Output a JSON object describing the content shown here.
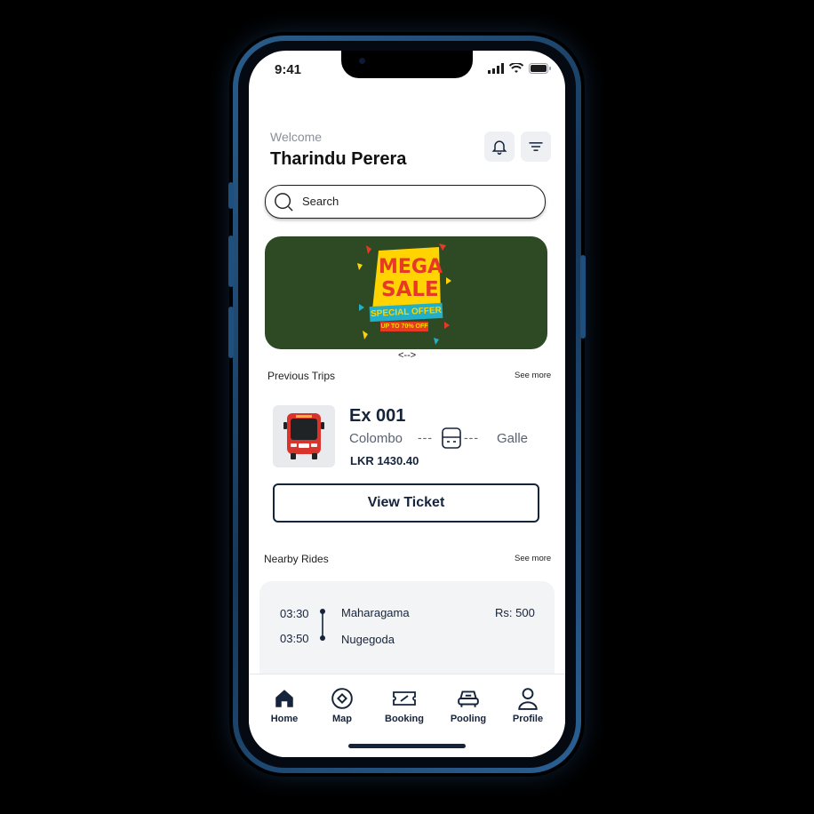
{
  "status_bar": {
    "time": "9:41"
  },
  "header": {
    "welcome": "Welcome",
    "user_name": "Tharindu Perera"
  },
  "search": {
    "placeholder": "Search"
  },
  "banner": {
    "title_line1": "MEGA",
    "title_line2": "SALE",
    "offer": "SPECIAL OFFER",
    "sub": "UP TO 70% OFF",
    "background": "#2e4a25"
  },
  "swipe_hint": "<-->",
  "previous_trips": {
    "title": "Previous Trips",
    "see_more": "See more",
    "trip": {
      "code": "Ex 001",
      "from": "Colombo",
      "to": "Galle",
      "connector": "---",
      "price": "LKR 1430.40",
      "view_ticket": "View Ticket"
    }
  },
  "nearby_rides": {
    "title": "Nearby Rides",
    "see_more": "See more",
    "ride": {
      "depart_time": "03:30",
      "arrive_time": "03:50",
      "from": "Maharagama",
      "to": "Nugegoda",
      "price": "Rs: 500"
    }
  },
  "bottom_nav": {
    "items": [
      {
        "label": "Home",
        "icon": "home-icon",
        "active": true
      },
      {
        "label": "Map",
        "icon": "compass-icon"
      },
      {
        "label": "Booking",
        "icon": "ticket-icon"
      },
      {
        "label": "Pooling",
        "icon": "car-icon"
      },
      {
        "label": "Profile",
        "icon": "user-icon"
      }
    ]
  },
  "colors": {
    "primary": "#15233b",
    "muted": "#8b8f98",
    "accent_red": "#e63a26"
  }
}
